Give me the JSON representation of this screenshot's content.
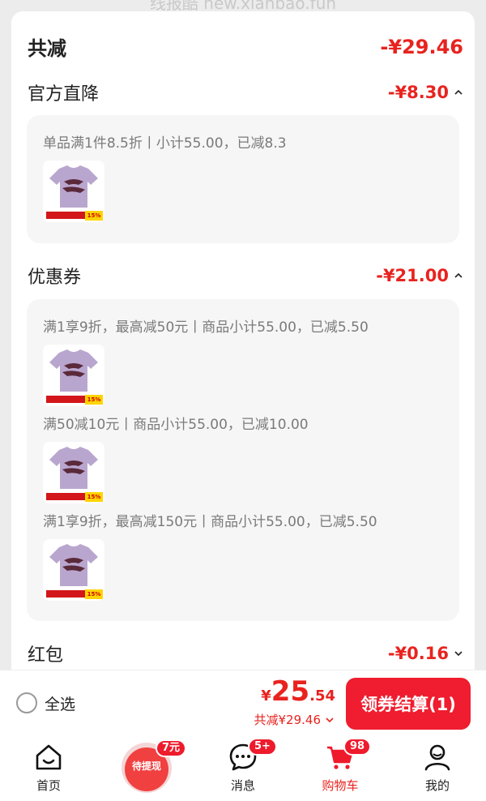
{
  "watermark": "线报酷 new.xianbao.fun",
  "summary": {
    "total_label": "共减",
    "total_amount": "-¥29.46"
  },
  "official": {
    "label": "官方直降",
    "amount": "-¥8.30",
    "rule": "单品满1件8.5折丨小计55.00，已减8.3",
    "tag_text": "15%"
  },
  "coupon": {
    "label": "优惠券",
    "amount": "-¥21.00",
    "rules": [
      "满1享9折，最高减50元丨商品小计55.00，已减5.50",
      "满50减10元丨商品小计55.00，已减10.00",
      "满1享9折，最高减150元丨商品小计55.00，已减5.50"
    ],
    "tag_text": "15%"
  },
  "redpacket": {
    "label": "红包",
    "amount": "-¥0.16"
  },
  "bottom": {
    "select_all": "全选",
    "currency": "¥",
    "price_int": "25",
    "price_dec": ".54",
    "reduced": "共减¥29.46",
    "checkout": "领券结算(1)"
  },
  "tabs": {
    "home": "首页",
    "promo_badge": "7元",
    "promo_text": "待提现",
    "messages": "消息",
    "messages_badge": "5+",
    "cart": "购物车",
    "cart_badge": "98",
    "mine": "我的"
  },
  "colors": {
    "accent": "#e8231f",
    "checkout_bg": "#ef1d2f",
    "shirt": "#b9a6cf"
  }
}
